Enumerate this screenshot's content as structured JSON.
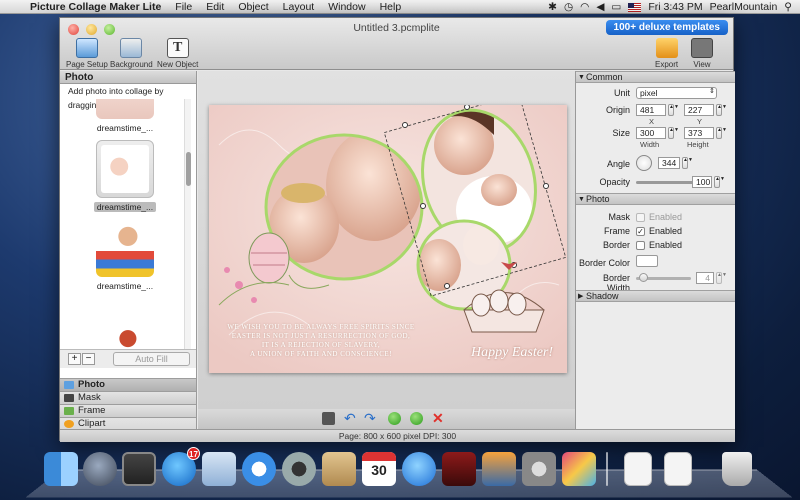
{
  "menubar": {
    "app_name": "Picture Collage Maker Lite",
    "items": [
      "File",
      "Edit",
      "Object",
      "Layout",
      "Window",
      "Help"
    ],
    "clock": "Fri 3:43 PM",
    "user": "PearlMountain"
  },
  "window": {
    "title": "Untitled 3.pcmplite",
    "deluxe_button": "100+ deluxe templates",
    "toolbar": {
      "page_setup": "Page Setup",
      "background": "Background",
      "new_object": "New Object",
      "export": "Export",
      "view": "View"
    }
  },
  "left_panel": {
    "header": "Photo",
    "hint": "Add photo into collage by dragging",
    "thumbnails": [
      {
        "caption": "dreamstime_...",
        "selected": false
      },
      {
        "caption": "dreamstime_...",
        "selected": true
      },
      {
        "caption": "dreamstime_...",
        "selected": false
      }
    ],
    "add_label": "+",
    "remove_label": "−",
    "auto_fill": "Auto Fill",
    "tabs": [
      "Photo",
      "Mask",
      "Frame",
      "Clipart"
    ]
  },
  "artwork": {
    "verse": [
      "We wish you to be always free spirits since",
      "Easter is not just a Resurrection of God,",
      "it is a rejection of slavery,",
      "a union of faith and conscience!"
    ],
    "greeting": "Happy Easter!"
  },
  "status": "Page: 800 x 600 pixel DPI: 300",
  "inspector": {
    "common": {
      "title": "Common",
      "unit_label": "Unit",
      "unit_value": "pixel",
      "origin_label": "Origin",
      "origin_x": "481",
      "origin_y": "227",
      "x_label": "X",
      "y_label": "Y",
      "size_label": "Size",
      "width": "300",
      "height": "373",
      "width_label": "Width",
      "height_label": "Height",
      "angle_label": "Angle",
      "angle": "344",
      "opacity_label": "Opacity",
      "opacity": "100"
    },
    "photo": {
      "title": "Photo",
      "mask_label": "Mask",
      "mask_value": "Enabled",
      "frame_label": "Frame",
      "frame_value": "Enabled",
      "border_label": "Border",
      "border_value": "Enabled",
      "border_color_label": "Border Color",
      "border_width_label": "Border Width",
      "border_width": "4"
    },
    "shadow": {
      "title": "Shadow"
    }
  },
  "dock": {
    "mail_badge": "17",
    "calendar_day": "30"
  },
  "colors": {
    "accent": "#1f6fd6",
    "artwork_bg": "#f2dcd8",
    "frame_green": "#a8d86a"
  }
}
